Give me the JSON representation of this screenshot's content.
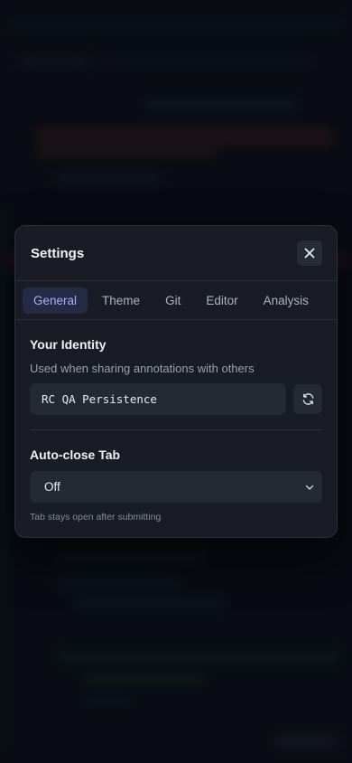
{
  "modal": {
    "title": "Settings",
    "close_icon": "close-icon"
  },
  "tabs": [
    {
      "label": "General",
      "active": true
    },
    {
      "label": "Theme",
      "active": false
    },
    {
      "label": "Git",
      "active": false
    },
    {
      "label": "Editor",
      "active": false
    },
    {
      "label": "Analysis",
      "active": false
    }
  ],
  "identity": {
    "title": "Your Identity",
    "description": "Used when sharing annotations with others",
    "value": "RC QA Persistence",
    "refresh_icon": "refresh-icon"
  },
  "auto_close": {
    "title": "Auto-close Tab",
    "selected": "Off",
    "hint": "Tab stays open after submitting",
    "chevron_icon": "chevron-down-icon"
  },
  "colors": {
    "accent": "#a3b0ff",
    "accent_bg": "#252b45",
    "modal_bg": "#191c24",
    "page_bg": "#0b0f17"
  }
}
